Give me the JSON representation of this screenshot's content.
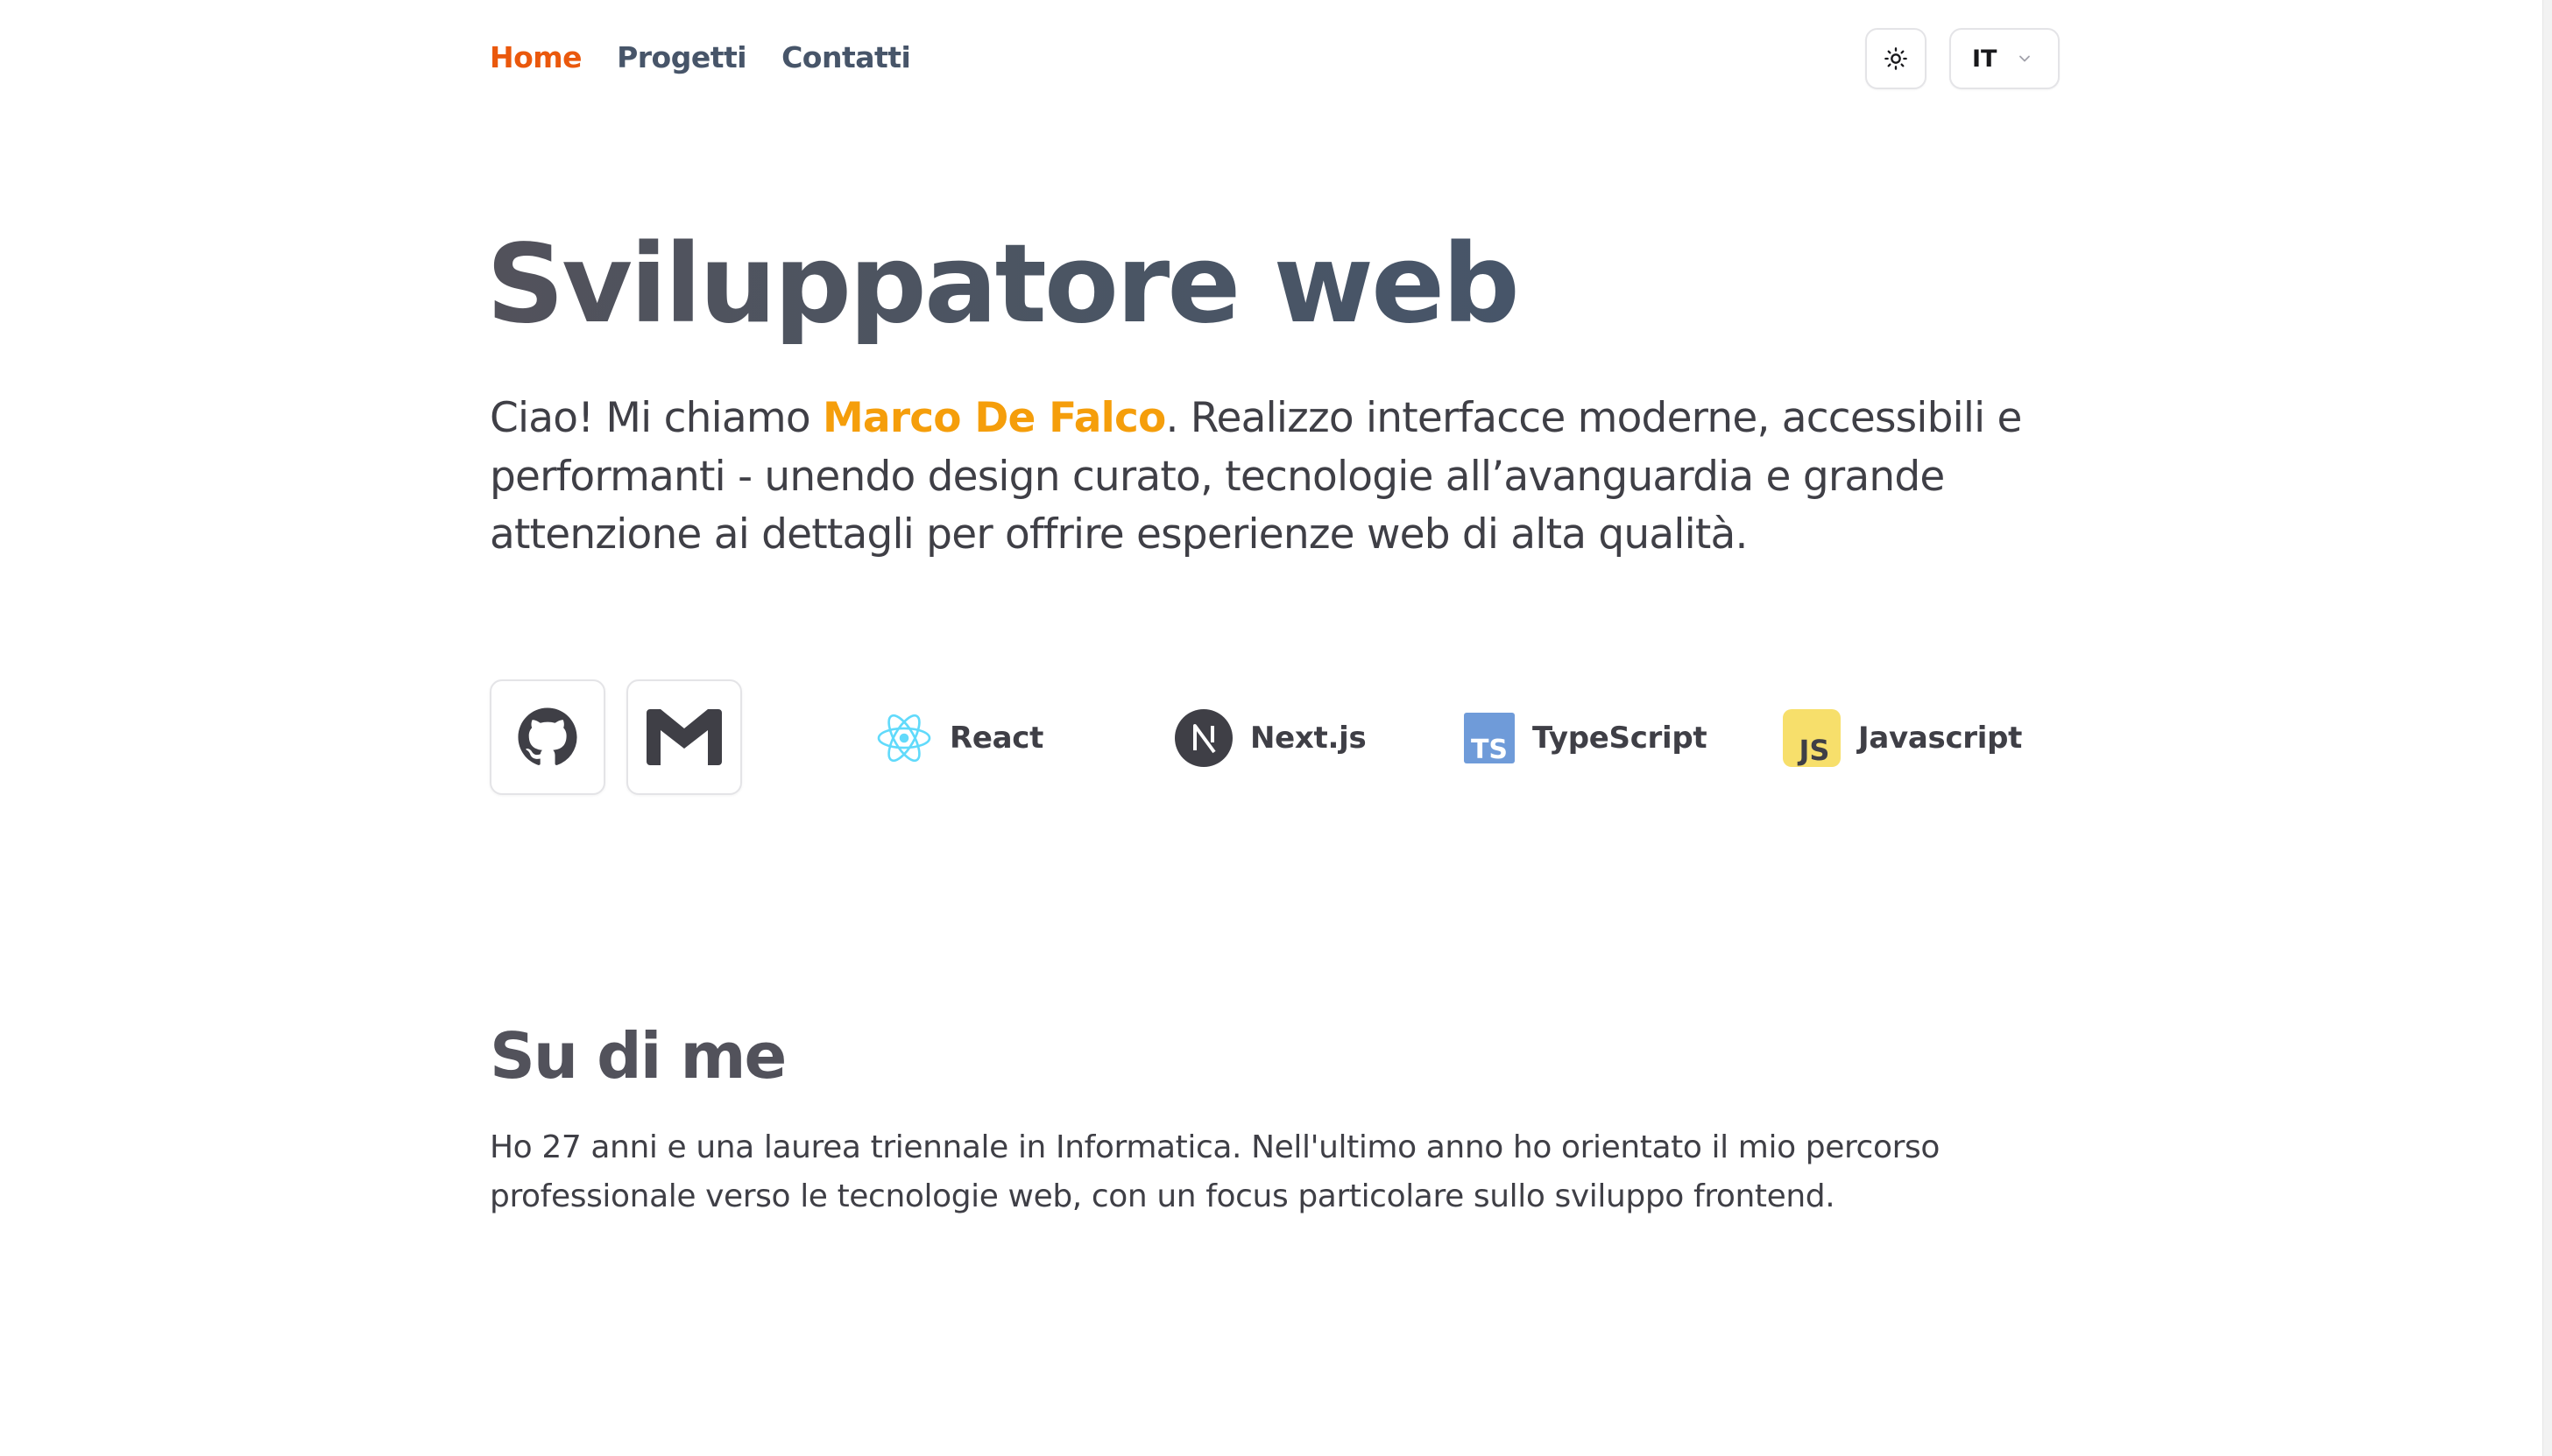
{
  "nav": {
    "items": [
      {
        "label": "Home",
        "active": true
      },
      {
        "label": "Progetti",
        "active": false
      },
      {
        "label": "Contatti",
        "active": false
      }
    ]
  },
  "header": {
    "theme_icon": "sun-icon",
    "language": {
      "selected": "IT",
      "icon": "chevron-down-icon"
    }
  },
  "hero": {
    "title": "Sviluppatore web",
    "intro_before": "Ciao! Mi chiamo ",
    "name": "Marco De Falco",
    "intro_after": ". Realizzo interfacce moderne, accessibili e performanti - unendo design curato, tecnologie all’avanguardia e grande attenzione ai dettagli per offrire esperienze web di alta qualità."
  },
  "social": [
    {
      "icon": "github-icon"
    },
    {
      "icon": "gmail-icon"
    }
  ],
  "tech": [
    {
      "label": "React",
      "icon": "react-icon",
      "color": "#61dafb"
    },
    {
      "label": "Next.js",
      "icon": "nextjs-icon",
      "color": "#3f3f46"
    },
    {
      "label": "TypeScript",
      "icon": "typescript-icon",
      "color": "#6f9bd9"
    },
    {
      "label": "Javascript",
      "icon": "javascript-icon",
      "color": "#f7df6b"
    }
  ],
  "about": {
    "title": "Su di me",
    "text": "Ho 27 anni e una laurea triennale in Informatica. Nell'ultimo anno ho orientato il mio percorso professionale verso le tecnologie web, con un focus particolare sullo sviluppo frontend."
  },
  "colors": {
    "accent": "#ea580c",
    "name_highlight": "#f59e0b",
    "text": "#3f3f46",
    "border": "#e4e4e7"
  }
}
